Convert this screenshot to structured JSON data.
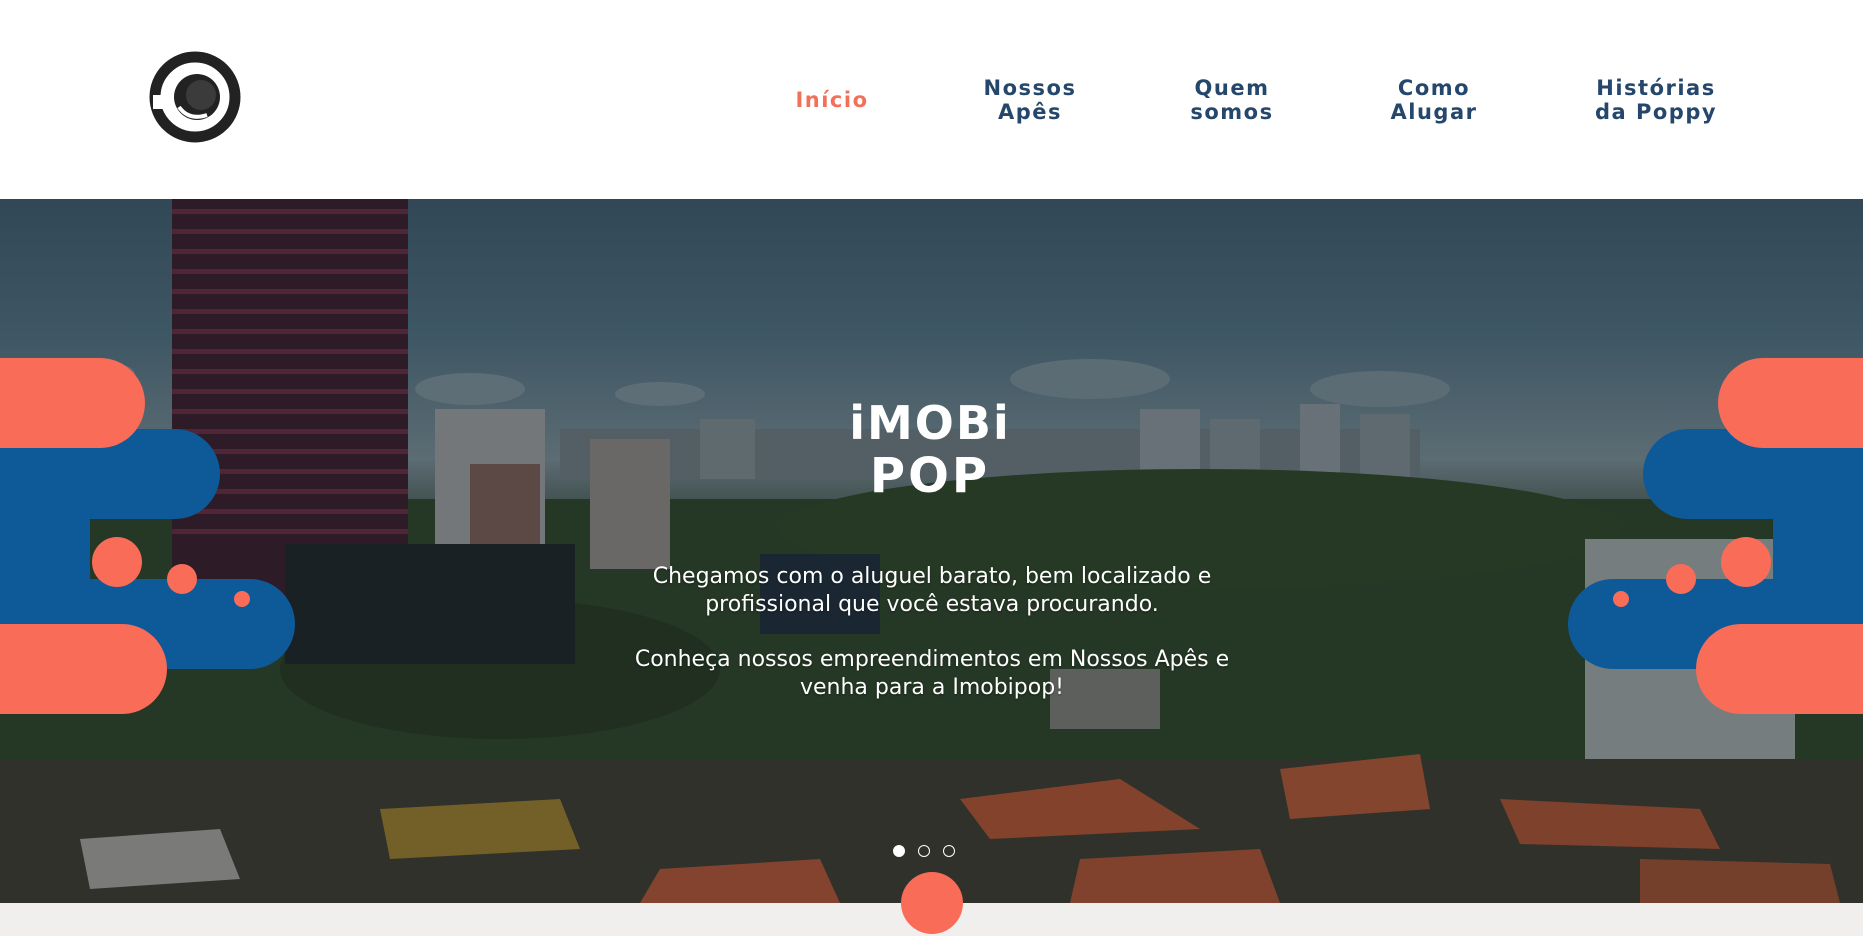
{
  "header": {
    "logo_icon": "imobipop-circle-logo-icon",
    "nav": [
      {
        "label": "Início",
        "active": true
      },
      {
        "label": "Nossos\nApês",
        "active": false
      },
      {
        "label": "Quem\nsomos",
        "active": false
      },
      {
        "label": "Como\nAlugar",
        "active": false
      },
      {
        "label": "Histórias\nda Poppy",
        "active": false
      }
    ]
  },
  "hero": {
    "brand_line1": "iMOBi",
    "brand_line2": "POP",
    "text_1": "Chegamos com o aluguel barato, bem localizado e\nprofissional que você estava procurando.",
    "text_2": "Conheça nossos empreendimentos em Nossos Apês e\nvenha para a Imobipop!",
    "slider": {
      "count": 3,
      "active_index": 0
    }
  },
  "colors": {
    "accent": "#f86c58",
    "nav_text": "#25476b",
    "blue_shape": "#0e5a98",
    "logo_dark": "#222222",
    "strip": "#f1eeee"
  }
}
